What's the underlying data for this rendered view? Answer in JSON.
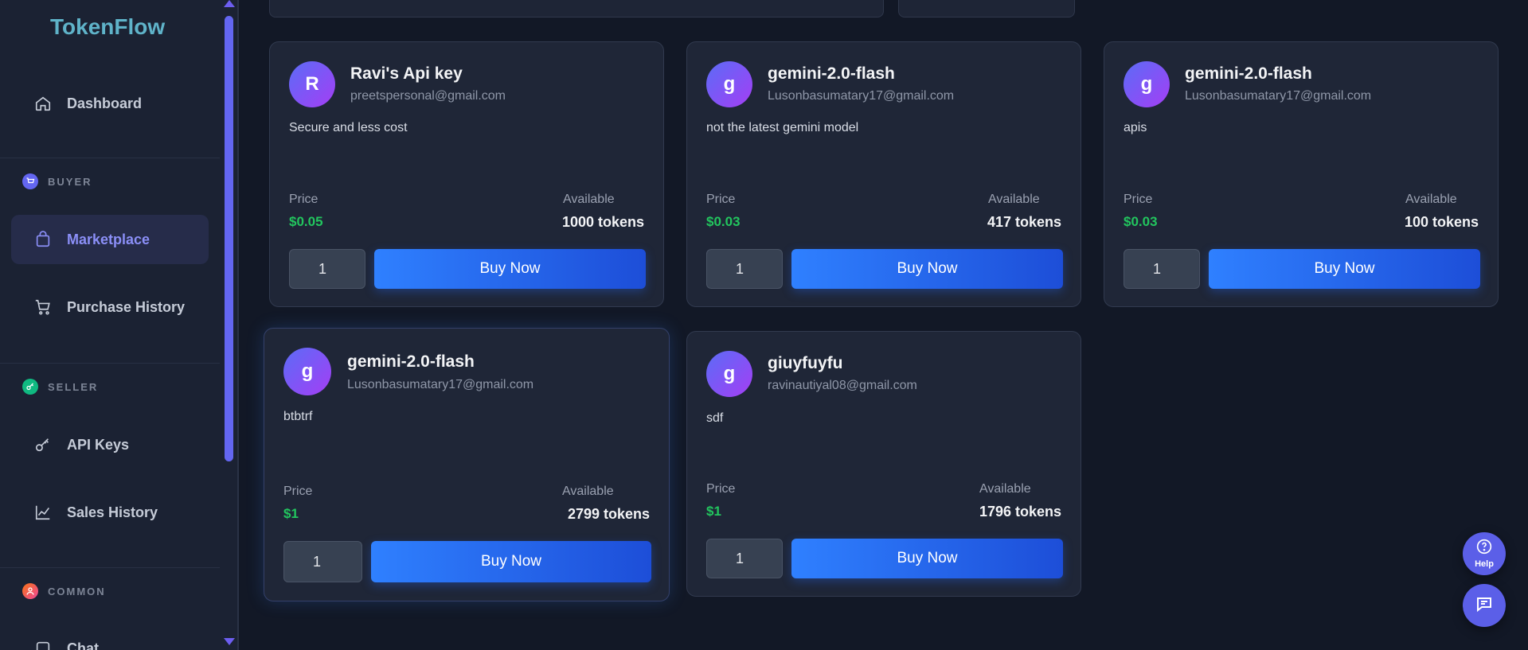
{
  "app": {
    "name": "TokenFlow"
  },
  "sidebar": {
    "dashboard": "Dashboard",
    "sections": {
      "buyer": "BUYER",
      "seller": "SELLER",
      "common": "COMMON"
    },
    "marketplace": "Marketplace",
    "purchase_history": "Purchase History",
    "api_keys": "API Keys",
    "sales_history": "Sales History",
    "chat": "Chat"
  },
  "labels": {
    "price": "Price",
    "available": "Available",
    "buy_now": "Buy Now",
    "help": "Help"
  },
  "listings": [
    {
      "initial": "R",
      "title": "Ravi's Api key",
      "email": "preetspersonal@gmail.com",
      "description": "Secure and less cost",
      "price": "$0.05",
      "available": "1000 tokens",
      "quantity": "1"
    },
    {
      "initial": "g",
      "title": "gemini-2.0-flash",
      "email": "Lusonbasumatary17@gmail.com",
      "description": "not the latest gemini model",
      "price": "$0.03",
      "available": "417 tokens",
      "quantity": "1"
    },
    {
      "initial": "g",
      "title": "gemini-2.0-flash",
      "email": "Lusonbasumatary17@gmail.com",
      "description": "apis",
      "price": "$0.03",
      "available": "100 tokens",
      "quantity": "1"
    },
    {
      "initial": "g",
      "title": "gemini-2.0-flash",
      "email": "Lusonbasumatary17@gmail.com",
      "description": "btbtrf",
      "price": "$1",
      "available": "2799 tokens",
      "quantity": "1"
    },
    {
      "initial": "g",
      "title": "giuyfuyfu",
      "email": "ravinautiyal08@gmail.com",
      "description": "sdf",
      "price": "$1",
      "available": "1796 tokens",
      "quantity": "1"
    }
  ],
  "colors": {
    "accent": "#6366f1",
    "price_green": "#22c55e",
    "buy_button": "#2563eb",
    "background": "#121826"
  }
}
